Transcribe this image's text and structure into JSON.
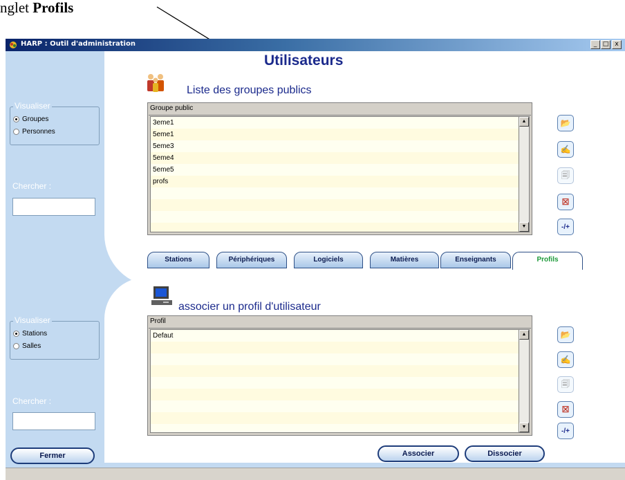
{
  "caption": {
    "prefix": "nglet ",
    "bold": "Profils"
  },
  "window": {
    "title": "HARP : Outil d'administration",
    "controls": [
      "_",
      "□",
      "x"
    ]
  },
  "main_title": "Utilisateurs",
  "top_section": {
    "title": "Liste des groupes publics",
    "icon": "people-group-icon",
    "visualiser": {
      "legend": "Visualiser",
      "options": [
        "Groupes",
        "Personnes"
      ],
      "selected": "Groupes"
    },
    "search_label": "Chercher :",
    "list_header": "Groupe public",
    "items": [
      "3eme1",
      "5eme1",
      "5eme3",
      "5eme4",
      "5eme5",
      "profs"
    ]
  },
  "tabs": [
    "Stations",
    "Périphériques",
    "Logiciels",
    "Matières",
    "Enseignants",
    "Profils"
  ],
  "active_tab": "Profils",
  "bottom_section": {
    "title": "associer un profil d'utilisateur",
    "icon": "computer-icon",
    "visualiser": {
      "legend": "Visualiser",
      "options": [
        "Stations",
        "Salles"
      ],
      "selected": "Stations"
    },
    "search_label": "Chercher :",
    "list_header": "Profil",
    "items": [
      "Defaut"
    ]
  },
  "buttons": {
    "close": "Fermer",
    "associate": "Associer",
    "dissociate": "Dissocier",
    "plus_minus": "-/+"
  },
  "colors": {
    "accent": "#1b2a8c",
    "sidebar": "#c3daf1",
    "active_tab_text": "#1d9a3a"
  }
}
